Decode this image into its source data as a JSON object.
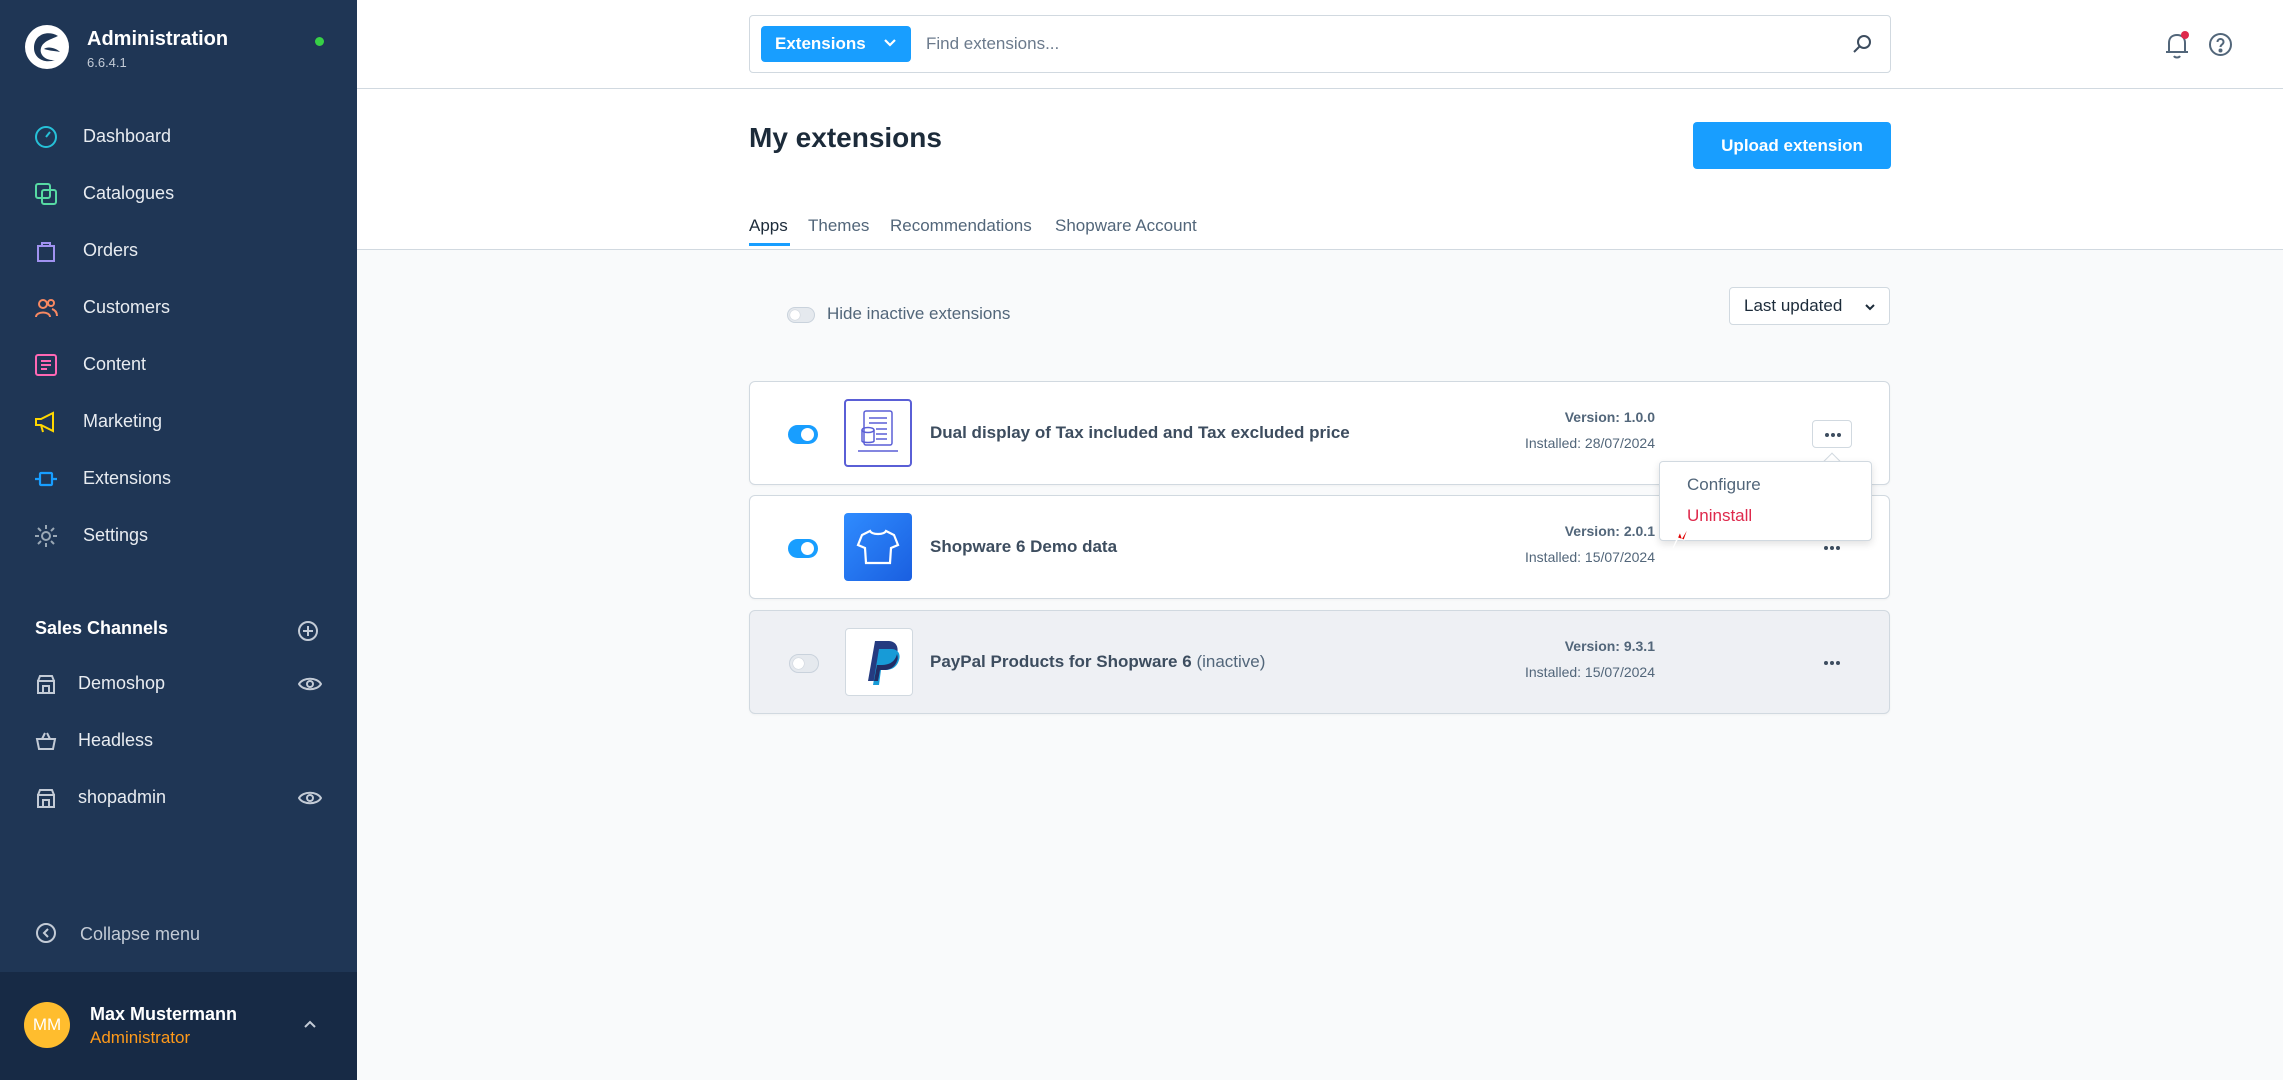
{
  "sidebar": {
    "title": "Administration",
    "version": "6.6.4.1",
    "nav": [
      {
        "label": "Dashboard",
        "icon": "dashboard-icon",
        "color": "#26c1d8"
      },
      {
        "label": "Catalogues",
        "icon": "catalogues-icon",
        "color": "#57d9a3"
      },
      {
        "label": "Orders",
        "icon": "orders-icon",
        "color": "#a092f0"
      },
      {
        "label": "Customers",
        "icon": "customers-icon",
        "color": "#f88962"
      },
      {
        "label": "Content",
        "icon": "content-icon",
        "color": "#ff68b4"
      },
      {
        "label": "Marketing",
        "icon": "marketing-icon",
        "color": "#ffd700"
      },
      {
        "label": "Extensions",
        "icon": "extensions-icon",
        "color": "#189eff"
      },
      {
        "label": "Settings",
        "icon": "settings-icon",
        "color": "#9aa8b5"
      }
    ],
    "sales_channels_title": "Sales Channels",
    "sales_channels": [
      {
        "label": "Demoshop",
        "icon": "storefront-icon",
        "visible_icon": true
      },
      {
        "label": "Headless",
        "icon": "basket-icon",
        "visible_icon": false
      },
      {
        "label": "shopadmin",
        "icon": "storefront-icon",
        "visible_icon": true
      }
    ],
    "collapse_label": "Collapse menu",
    "user": {
      "initials": "MM",
      "name": "Max Mustermann",
      "role": "Administrator"
    }
  },
  "topbar": {
    "search_type": "Extensions",
    "search_placeholder": "Find extensions..."
  },
  "page": {
    "title": "My extensions",
    "upload_button": "Upload extension",
    "tabs": [
      {
        "label": "Apps",
        "active": true
      },
      {
        "label": "Themes",
        "active": false
      },
      {
        "label": "Recommendations",
        "active": false
      },
      {
        "label": "Shopware Account",
        "active": false
      }
    ],
    "hide_inactive_label": "Hide inactive extensions",
    "sort_label": "Last updated"
  },
  "extensions": [
    {
      "name": "Dual display of Tax included and Tax excluded price",
      "inactive_tag": "",
      "version": "Version: 1.0.0",
      "installed": "Installed: 28/07/2024",
      "active": true
    },
    {
      "name": "Shopware 6 Demo data",
      "inactive_tag": "",
      "version": "Version: 2.0.1",
      "installed": "Installed: 15/07/2024",
      "active": true
    },
    {
      "name": "PayPal Products for Shopware 6",
      "inactive_tag": "(inactive)",
      "version": "Version: 9.3.1",
      "installed": "Installed: 15/07/2024",
      "active": false
    }
  ],
  "context_menu": {
    "configure": "Configure",
    "uninstall": "Uninstall",
    "uninstall_color": "#de294c"
  },
  "colors": {
    "accent": "#189eff",
    "sidebar": "#1f3655"
  }
}
